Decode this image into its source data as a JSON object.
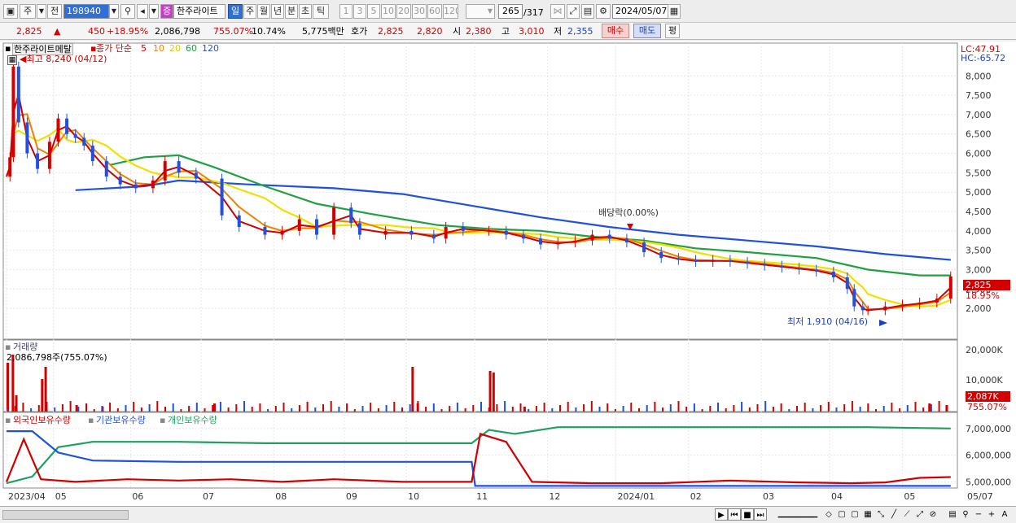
{
  "toolbar": {
    "type_label": "주",
    "sub_label": "전",
    "code_value": "198940",
    "badge_label": "증",
    "stock_name": "한주라이트",
    "periods": [
      "일",
      "주",
      "월",
      "년",
      "분",
      "초",
      "틱"
    ],
    "active_period": "일",
    "intervals": [
      "1",
      "3",
      "5",
      "10",
      "20",
      "30",
      "60",
      "120"
    ],
    "count_value": "265",
    "count_total": "/317",
    "date_value": "2024/05/07"
  },
  "info": {
    "price": "2,825",
    "change_arrow": "▲",
    "change": "450",
    "change_pct": "+18.95%",
    "volume": "2,086,798",
    "volume_pct": "755.07%",
    "turnover_pct": "10.74%",
    "amount": "5,775백만",
    "quote_label": "호가",
    "ask": "2,825",
    "bid": "2,820",
    "open_label": "시",
    "open": "2,380",
    "high_label": "고",
    "high": "3,010",
    "low_label": "저",
    "low": "2,355",
    "buy_label": "매수",
    "sell_label": "매도",
    "avg_label": "평"
  },
  "main_chart": {
    "stock_label": "한주라이트메탈",
    "ma_prefix": "종가 단순",
    "ma_periods": [
      "5",
      "10",
      "20",
      "60",
      "120"
    ],
    "ma_colors": [
      "#d00000",
      "#f08000",
      "#f0e000",
      "#20a040",
      "#2050e0"
    ],
    "high_marker": "최고 8,240 (04/12)",
    "low_marker": "최저 1,910 (04/16)",
    "dividend_label": "배당락(0.00%)",
    "lc_label": "LC:47.91",
    "hc_label": "HC:-65.72",
    "last_price_tag": "2,825",
    "last_pct_tag": "18.95%"
  },
  "volume_chart": {
    "title": "거래량",
    "value_label": "2,086,798주(755.07%)",
    "last_tag": "2,087K",
    "last_pct": "755.07%"
  },
  "holdings_chart": {
    "series_labels": [
      "외국인보유수량",
      "기관보유수량",
      "개인보유수량"
    ],
    "series_colors": [
      "#d00000",
      "#2050e0",
      "#20a060"
    ]
  },
  "chart_data": {
    "type": "line",
    "x_axis_labels": [
      "2023/04",
      "05",
      "06",
      "07",
      "08",
      "09",
      "10",
      "11",
      "12",
      "2024/01",
      "02",
      "03",
      "04",
      "05",
      "05/07"
    ],
    "price_axis": [
      "8,000",
      "7,500",
      "7,000",
      "6,500",
      "6,000",
      "5,500",
      "5,000",
      "4,500",
      "4,000",
      "3,500",
      "3,000",
      "2,500",
      "2,000"
    ],
    "price_ylim": [
      1750,
      8300
    ],
    "volume_axis": [
      "20,000K",
      "10,000K"
    ],
    "holdings_axis": [
      "7,000,000",
      "6,000,000",
      "5,000,000"
    ],
    "price_points": [
      [
        0,
        5400
      ],
      [
        0.02,
        5900
      ],
      [
        0.04,
        8240
      ],
      [
        0.07,
        6800
      ],
      [
        0.12,
        6000
      ],
      [
        0.18,
        5600
      ],
      [
        0.25,
        6300
      ],
      [
        0.3,
        6900
      ],
      [
        0.35,
        6500
      ],
      [
        0.4,
        6400
      ],
      [
        0.45,
        6200
      ],
      [
        0.5,
        5800
      ],
      [
        0.58,
        5400
      ],
      [
        0.66,
        5200
      ],
      [
        0.75,
        5100
      ],
      [
        0.85,
        5300
      ],
      [
        0.92,
        5800
      ],
      [
        1.0,
        5500
      ],
      [
        1.1,
        5350
      ],
      [
        1.25,
        4400
      ],
      [
        1.35,
        4100
      ],
      [
        1.5,
        3900
      ],
      [
        1.6,
        4000
      ],
      [
        1.7,
        4300
      ],
      [
        1.8,
        3900
      ],
      [
        1.9,
        4600
      ],
      [
        2.0,
        4200
      ],
      [
        2.05,
        3900
      ],
      [
        2.2,
        4000
      ],
      [
        2.35,
        3900
      ],
      [
        2.48,
        3800
      ],
      [
        2.55,
        4100
      ],
      [
        2.65,
        4000
      ],
      [
        2.8,
        4000
      ],
      [
        2.9,
        3900
      ],
      [
        3.0,
        3800
      ],
      [
        3.1,
        3650
      ],
      [
        3.2,
        3700
      ],
      [
        3.3,
        3750
      ],
      [
        3.4,
        3900
      ],
      [
        3.5,
        3800
      ],
      [
        3.6,
        3700
      ],
      [
        3.7,
        3450
      ],
      [
        3.8,
        3300
      ],
      [
        3.9,
        3250
      ],
      [
        4.0,
        3200
      ],
      [
        4.1,
        3250
      ],
      [
        4.2,
        3200
      ],
      [
        4.3,
        3150
      ],
      [
        4.4,
        3100
      ],
      [
        4.5,
        3050
      ],
      [
        4.6,
        3000
      ],
      [
        4.7,
        2950
      ],
      [
        4.8,
        2800
      ],
      [
        4.88,
        2500
      ],
      [
        4.92,
        2050
      ],
      [
        4.97,
        1950
      ],
      [
        5.0,
        1950
      ],
      [
        5.1,
        2050
      ],
      [
        5.2,
        2100
      ],
      [
        5.3,
        2150
      ],
      [
        5.4,
        2250
      ],
      [
        5.48,
        2825
      ]
    ],
    "ma120_points": [
      [
        0.4,
        5050
      ],
      [
        0.8,
        5150
      ],
      [
        1.0,
        5300
      ],
      [
        1.4,
        5200
      ],
      [
        1.9,
        5100
      ],
      [
        2.3,
        4950
      ],
      [
        2.7,
        4650
      ],
      [
        3.1,
        4350
      ],
      [
        3.5,
        4100
      ],
      [
        3.9,
        3900
      ],
      [
        4.3,
        3750
      ],
      [
        4.7,
        3600
      ],
      [
        5.1,
        3400
      ],
      [
        5.48,
        3250
      ]
    ],
    "ma60_points": [
      [
        0.6,
        5700
      ],
      [
        0.8,
        5900
      ],
      [
        1.0,
        5950
      ],
      [
        1.2,
        5650
      ],
      [
        1.5,
        5150
      ],
      [
        1.8,
        4700
      ],
      [
        2.1,
        4450
      ],
      [
        2.5,
        4150
      ],
      [
        2.8,
        4050
      ],
      [
        3.1,
        4000
      ],
      [
        3.4,
        3850
      ],
      [
        3.7,
        3750
      ],
      [
        4.0,
        3550
      ],
      [
        4.3,
        3450
      ],
      [
        4.7,
        3300
      ],
      [
        5.0,
        3000
      ],
      [
        5.3,
        2850
      ],
      [
        5.48,
        2850
      ]
    ],
    "holdings_domain": [
      4800000,
      7300000
    ],
    "foreign_points": [
      [
        0,
        5000000
      ],
      [
        0.1,
        6600000
      ],
      [
        0.2,
        5100000
      ],
      [
        0.4,
        5000000
      ],
      [
        0.7,
        5100000
      ],
      [
        1.0,
        5050000
      ],
      [
        1.3,
        5100000
      ],
      [
        1.6,
        5000000
      ],
      [
        1.9,
        5100000
      ],
      [
        2.3,
        5000000
      ],
      [
        2.7,
        5000000
      ],
      [
        2.75,
        6800000
      ],
      [
        2.9,
        6500000
      ],
      [
        3.05,
        5000000
      ],
      [
        3.4,
        4950000
      ],
      [
        3.8,
        4950000
      ],
      [
        4.2,
        5050000
      ],
      [
        4.6,
        4980000
      ],
      [
        4.9,
        4950000
      ],
      [
        5.1,
        4980000
      ],
      [
        5.3,
        5150000
      ],
      [
        5.48,
        5180000
      ]
    ],
    "institution_points": [
      [
        0,
        6900000
      ],
      [
        0.15,
        6900000
      ],
      [
        0.3,
        6100000
      ],
      [
        0.5,
        5800000
      ],
      [
        1.0,
        5750000
      ],
      [
        2.7,
        5750000
      ],
      [
        2.72,
        4850000
      ],
      [
        5.48,
        4850000
      ]
    ],
    "individual_points": [
      [
        0,
        4950000
      ],
      [
        0.15,
        5200000
      ],
      [
        0.3,
        6300000
      ],
      [
        0.5,
        6500000
      ],
      [
        1.0,
        6500000
      ],
      [
        1.5,
        6450000
      ],
      [
        2.0,
        6450000
      ],
      [
        2.7,
        6450000
      ],
      [
        2.8,
        6950000
      ],
      [
        2.95,
        6800000
      ],
      [
        3.2,
        7050000
      ],
      [
        4.0,
        7050000
      ],
      [
        4.5,
        7050000
      ],
      [
        5.0,
        7050000
      ],
      [
        5.48,
        7000000
      ]
    ]
  }
}
